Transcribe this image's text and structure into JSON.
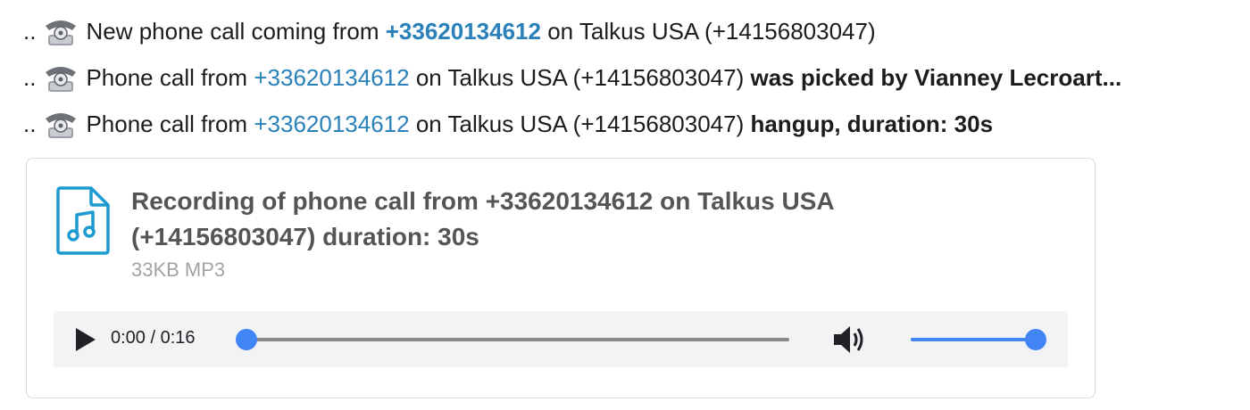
{
  "messages": [
    {
      "prefix": "..",
      "icon": "telephone-icon",
      "text_before": "New phone call coming from",
      "caller": "+33620134612",
      "text_after": "on Talkus USA (+14156803047)"
    },
    {
      "prefix": "..",
      "icon": "telephone-icon",
      "text_before": "Phone call from",
      "caller": "+33620134612",
      "text_after": "on Talkus USA (+14156803047)",
      "status": "was picked by Vianney Lecroart..."
    },
    {
      "prefix": "..",
      "icon": "telephone-icon",
      "text_before": "Phone call from",
      "caller": "+33620134612",
      "text_after": "on Talkus USA (+14156803047)",
      "status": "hangup, duration: 30s"
    }
  ],
  "attachment": {
    "icon": "audio-file-icon",
    "title_line1": "Recording of phone call from +33620134612 on Talkus USA",
    "title_line2": "(+14156803047) duration: 30s",
    "meta": "33KB MP3",
    "player": {
      "play_icon": "play-icon",
      "time": "0:00 / 0:16",
      "progress": 0.0,
      "volume_icon": "volume-icon",
      "volume": 1.0
    }
  },
  "colors": {
    "link": "#2a80b9",
    "accent": "#4285f4",
    "muted": "#a3a3a3",
    "file_icon": "#1d9bd1"
  }
}
